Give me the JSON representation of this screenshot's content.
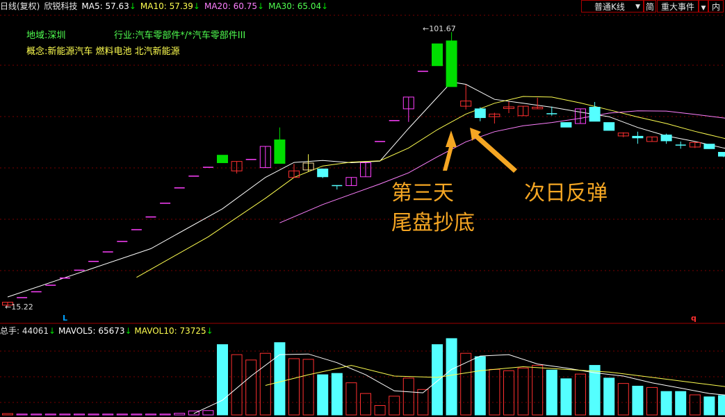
{
  "header": {
    "period": "日线(复权)",
    "stock_name": "欣锐科技",
    "ma5": "MA5: 57.63",
    "ma10": "MA10: 57.39",
    "ma20": "MA20: 60.75",
    "ma30": "MA30: 65.04",
    "arrow": "↓"
  },
  "toolbar": {
    "kline_type": "普通K线",
    "dropdown": "▼",
    "simple": "简",
    "events": "重大事件",
    "inner": "内"
  },
  "info": {
    "region": "地域:深圳",
    "industry": "行业:汽车零部件*/*汽车零部件III",
    "concept": "概念:新能源汽车 燃料电池 北汽新能源"
  },
  "annotations": {
    "day3_line1": "第三天",
    "day3_line2": "尾盘抄底",
    "rebound": "次日反弹"
  },
  "price_labels": {
    "high": "101.67",
    "low": "15.22",
    "left_marker": "L",
    "right_marker": "q"
  },
  "volume_header": {
    "vol": "总手: 44061",
    "mavol5": "MAVOL5: 65673",
    "mavol10": "MAVOL10: 73725",
    "arrow": "↓"
  },
  "colors": {
    "up": "#ff3030",
    "down_green": "#00dd00",
    "down_cyan": "#54ffff",
    "limit_up": "#ff40ff",
    "ma5": "#ffffff",
    "ma10": "#ffff50",
    "ma20": "#ff80ff",
    "annotation": "#f5a623",
    "grid": "#7a0000"
  },
  "chart_data": {
    "type": "candlestick",
    "price_range": [
      15.22,
      101.67
    ],
    "candles": [
      {
        "o": 16.8,
        "c": 15.9,
        "h": 16.8,
        "l": 15.22,
        "kind": "up"
      },
      {
        "o": 18.2,
        "c": 18.2,
        "h": 18.2,
        "l": 18.2,
        "kind": "limit"
      },
      {
        "o": 20.0,
        "c": 20.0,
        "h": 20.0,
        "l": 20.0,
        "kind": "limit"
      },
      {
        "o": 22.0,
        "c": 22.0,
        "h": 22.0,
        "l": 22.0,
        "kind": "limit"
      },
      {
        "o": 24.2,
        "c": 24.2,
        "h": 24.2,
        "l": 24.2,
        "kind": "limit"
      },
      {
        "o": 26.6,
        "c": 26.6,
        "h": 26.6,
        "l": 26.6,
        "kind": "limit"
      },
      {
        "o": 29.3,
        "c": 29.3,
        "h": 29.3,
        "l": 29.3,
        "kind": "limit"
      },
      {
        "o": 32.2,
        "c": 32.2,
        "h": 32.2,
        "l": 32.2,
        "kind": "limit"
      },
      {
        "o": 35.4,
        "c": 35.4,
        "h": 35.4,
        "l": 35.4,
        "kind": "limit"
      },
      {
        "o": 39.0,
        "c": 39.0,
        "h": 39.0,
        "l": 39.0,
        "kind": "limit"
      },
      {
        "o": 42.9,
        "c": 42.9,
        "h": 42.9,
        "l": 42.9,
        "kind": "limit"
      },
      {
        "o": 47.1,
        "c": 47.1,
        "h": 47.1,
        "l": 47.1,
        "kind": "limit"
      },
      {
        "o": 51.8,
        "c": 51.8,
        "h": 51.8,
        "l": 51.8,
        "kind": "limit"
      },
      {
        "o": 55.4,
        "c": 55.4,
        "h": 55.4,
        "l": 55.4,
        "kind": "limit"
      },
      {
        "o": 58.1,
        "c": 58.1,
        "h": 58.1,
        "l": 58.1,
        "kind": "limit"
      },
      {
        "o": 61.8,
        "c": 59.5,
        "h": 61.8,
        "l": 59.5,
        "kind": "green"
      },
      {
        "o": 57.0,
        "c": 59.9,
        "h": 59.9,
        "l": 56.2,
        "kind": "up"
      },
      {
        "o": 60.5,
        "c": 60.5,
        "h": 60.5,
        "l": 60.5,
        "kind": "limit"
      },
      {
        "o": 58.0,
        "c": 64.5,
        "h": 64.5,
        "l": 58.0,
        "kind": "limit_body"
      },
      {
        "o": 66.5,
        "c": 59.3,
        "h": 70.3,
        "l": 59.3,
        "kind": "green"
      },
      {
        "o": 55.0,
        "c": 57.0,
        "h": 59.1,
        "l": 55.0,
        "kind": "up"
      },
      {
        "o": 57.3,
        "c": 59.4,
        "h": 62.1,
        "l": 56.8,
        "kind": "up_yellow"
      },
      {
        "o": 57.6,
        "c": 55.2,
        "h": 57.6,
        "l": 54.8,
        "kind": "cyan"
      },
      {
        "o": 52.5,
        "c": 52.5,
        "h": 52.5,
        "l": 51.3,
        "kind": "cross"
      },
      {
        "o": 52.5,
        "c": 55.0,
        "h": 55.0,
        "l": 52.5,
        "kind": "limit_body"
      },
      {
        "o": 55.2,
        "c": 59.5,
        "h": 59.6,
        "l": 55.2,
        "kind": "limit_body"
      },
      {
        "o": 66.0,
        "c": 66.0,
        "h": 66.0,
        "l": 66.0,
        "kind": "limit"
      },
      {
        "o": 72.4,
        "c": 72.4,
        "h": 72.4,
        "l": 72.4,
        "kind": "limit"
      },
      {
        "o": 76.0,
        "c": 79.6,
        "h": 79.6,
        "l": 72.0,
        "kind": "limit_body"
      },
      {
        "o": 87.5,
        "c": 87.5,
        "h": 87.5,
        "l": 87.5,
        "kind": "limit"
      },
      {
        "o": 89.2,
        "c": 95.9,
        "h": 95.9,
        "l": 89.2,
        "kind": "green"
      },
      {
        "o": 96.8,
        "c": 82.8,
        "h": 99.5,
        "l": 82.8,
        "kind": "green"
      },
      {
        "o": 76.8,
        "c": 78.4,
        "h": 83.4,
        "l": 75.8,
        "kind": "up"
      },
      {
        "o": 76.0,
        "c": 73.3,
        "h": 76.5,
        "l": 72.2,
        "kind": "cyan"
      },
      {
        "o": 73.6,
        "c": 74.4,
        "h": 74.8,
        "l": 71.5,
        "kind": "up"
      },
      {
        "o": 76.1,
        "c": 76.6,
        "h": 78.2,
        "l": 74.7,
        "kind": "up"
      },
      {
        "o": 73.9,
        "c": 76.8,
        "h": 76.8,
        "l": 73.9,
        "kind": "up"
      },
      {
        "o": 76.0,
        "c": 76.5,
        "h": 79.4,
        "l": 76.0,
        "kind": "up"
      },
      {
        "o": 74.1,
        "c": 74.5,
        "h": 76.7,
        "l": 73.9,
        "kind": "cross"
      },
      {
        "o": 71.8,
        "c": 70.4,
        "h": 71.8,
        "l": 70.4,
        "kind": "cyan"
      },
      {
        "o": 71.5,
        "c": 76.0,
        "h": 76.0,
        "l": 71.5,
        "kind": "limit_body"
      },
      {
        "o": 76.5,
        "c": 72.2,
        "h": 78.1,
        "l": 72.2,
        "kind": "cyan"
      },
      {
        "o": 71.8,
        "c": 69.4,
        "h": 71.8,
        "l": 69.4,
        "kind": "cyan"
      },
      {
        "o": 68.6,
        "c": 67.7,
        "h": 68.8,
        "l": 67.3,
        "kind": "up"
      },
      {
        "o": 67.6,
        "c": 67.1,
        "h": 69.0,
        "l": 65.3,
        "kind": "cyan"
      },
      {
        "o": 66.0,
        "c": 67.4,
        "h": 67.4,
        "l": 66.0,
        "kind": "up"
      },
      {
        "o": 68.0,
        "c": 66.2,
        "h": 68.4,
        "l": 65.3,
        "kind": "cyan"
      },
      {
        "o": 64.9,
        "c": 64.8,
        "h": 66.0,
        "l": 63.8,
        "kind": "cross"
      },
      {
        "o": 64.3,
        "c": 65.7,
        "h": 65.7,
        "l": 64.0,
        "kind": "up"
      },
      {
        "o": 65.2,
        "c": 63.8,
        "h": 65.2,
        "l": 63.8,
        "kind": "cyan"
      },
      {
        "o": 62.7,
        "c": 61.5,
        "h": 62.7,
        "l": 61.2,
        "kind": "cyan"
      },
      {
        "o": 61.5,
        "c": 60.3,
        "h": 61.9,
        "l": 60.3,
        "kind": "cyan"
      },
      {
        "o": 58.8,
        "c": 58.8,
        "h": 60.3,
        "l": 58.8,
        "kind": "up"
      }
    ],
    "ma5": [
      [
        0,
        18.4
      ],
      [
        10,
        33.2
      ],
      [
        15,
        45.4
      ],
      [
        18,
        55.0
      ],
      [
        20,
        59.6
      ],
      [
        22,
        60.2
      ],
      [
        24,
        59.5
      ],
      [
        26,
        60.0
      ],
      [
        28,
        70.0
      ],
      [
        30,
        79.5
      ],
      [
        31,
        84.2
      ],
      [
        32,
        83.5
      ],
      [
        34,
        78.9
      ],
      [
        36,
        77.7
      ],
      [
        38,
        76.5
      ],
      [
        40,
        75.0
      ],
      [
        42,
        73.6
      ],
      [
        44,
        70.3
      ],
      [
        46,
        67.7
      ],
      [
        48,
        66.0
      ],
      [
        50,
        64.0
      ],
      [
        52,
        62.5
      ]
    ],
    "ma10": [
      [
        9,
        24.4
      ],
      [
        14,
        36.8
      ],
      [
        18,
        48.6
      ],
      [
        20,
        55.0
      ],
      [
        22,
        58.5
      ],
      [
        24,
        59.7
      ],
      [
        26,
        60.1
      ],
      [
        28,
        64.0
      ],
      [
        30,
        69.6
      ],
      [
        32,
        74.4
      ],
      [
        34,
        77.7
      ],
      [
        36,
        79.8
      ],
      [
        38,
        79.6
      ],
      [
        40,
        77.8
      ],
      [
        42,
        75.7
      ],
      [
        44,
        73.5
      ],
      [
        46,
        71.5
      ],
      [
        48,
        69.1
      ],
      [
        50,
        67.0
      ],
      [
        52,
        64.9
      ]
    ],
    "ma20": [
      [
        19,
        41.1
      ],
      [
        22,
        46.7
      ],
      [
        26,
        53.0
      ],
      [
        28,
        56.4
      ],
      [
        30,
        61.3
      ],
      [
        32,
        65.9
      ],
      [
        34,
        69.0
      ],
      [
        36,
        70.8
      ],
      [
        38,
        71.8
      ],
      [
        40,
        73.1
      ],
      [
        42,
        74.7
      ],
      [
        44,
        75.4
      ],
      [
        46,
        75.3
      ],
      [
        48,
        74.3
      ],
      [
        50,
        73.2
      ],
      [
        52,
        72.0
      ]
    ],
    "ma30": [
      [
        29,
        53.8
      ],
      [
        32,
        57.6
      ],
      [
        34,
        61.1
      ],
      [
        36,
        63.7
      ],
      [
        38,
        65.3
      ],
      [
        40,
        67.3
      ],
      [
        42,
        68.5
      ],
      [
        44,
        69.3
      ],
      [
        46,
        69.0
      ],
      [
        48,
        68.0
      ],
      [
        50,
        66.5
      ],
      [
        52,
        65.6
      ]
    ],
    "volume": {
      "range": [
        0,
        115000
      ],
      "bars": [
        {
          "v": 2000,
          "kind": "up"
        },
        {
          "v": 1300,
          "kind": "limit"
        },
        {
          "v": 1300,
          "kind": "limit"
        },
        {
          "v": 1300,
          "kind": "limit"
        },
        {
          "v": 1300,
          "kind": "limit"
        },
        {
          "v": 1300,
          "kind": "limit"
        },
        {
          "v": 1300,
          "kind": "limit"
        },
        {
          "v": 1300,
          "kind": "limit"
        },
        {
          "v": 1300,
          "kind": "limit"
        },
        {
          "v": 1300,
          "kind": "limit"
        },
        {
          "v": 1300,
          "kind": "limit"
        },
        {
          "v": 1300,
          "kind": "limit"
        },
        {
          "v": 2500,
          "kind": "limit"
        },
        {
          "v": 6000,
          "kind": "limit"
        },
        {
          "v": 6500,
          "kind": "limit"
        },
        {
          "v": 105000,
          "kind": "cyan"
        },
        {
          "v": 90000,
          "kind": "up"
        },
        {
          "v": 82000,
          "kind": "up"
        },
        {
          "v": 92000,
          "kind": "up"
        },
        {
          "v": 108000,
          "kind": "cyan"
        },
        {
          "v": 84000,
          "kind": "up"
        },
        {
          "v": 83000,
          "kind": "up"
        },
        {
          "v": 60000,
          "kind": "cyan"
        },
        {
          "v": 62000,
          "kind": "cyan"
        },
        {
          "v": 48000,
          "kind": "up"
        },
        {
          "v": 32000,
          "kind": "up"
        },
        {
          "v": 14000,
          "kind": "up"
        },
        {
          "v": 28000,
          "kind": "up"
        },
        {
          "v": 55000,
          "kind": "up"
        },
        {
          "v": 38000,
          "kind": "up"
        },
        {
          "v": 105000,
          "kind": "cyan"
        },
        {
          "v": 114000,
          "kind": "cyan"
        },
        {
          "v": 92000,
          "kind": "up"
        },
        {
          "v": 87000,
          "kind": "cyan"
        },
        {
          "v": 68000,
          "kind": "up"
        },
        {
          "v": 66000,
          "kind": "up"
        },
        {
          "v": 70000,
          "kind": "up"
        },
        {
          "v": 74000,
          "kind": "up"
        },
        {
          "v": 67000,
          "kind": "cyan"
        },
        {
          "v": 54000,
          "kind": "cyan"
        },
        {
          "v": 61000,
          "kind": "up"
        },
        {
          "v": 74000,
          "kind": "cyan"
        },
        {
          "v": 55000,
          "kind": "cyan"
        },
        {
          "v": 47000,
          "kind": "up"
        },
        {
          "v": 43000,
          "kind": "cyan"
        },
        {
          "v": 41000,
          "kind": "up"
        },
        {
          "v": 35000,
          "kind": "cyan"
        },
        {
          "v": 35000,
          "kind": "cyan"
        },
        {
          "v": 30000,
          "kind": "up"
        },
        {
          "v": 27000,
          "kind": "cyan"
        },
        {
          "v": 29000,
          "kind": "cyan"
        },
        {
          "v": 25000,
          "kind": "cyan"
        },
        {
          "v": 30000,
          "kind": "up"
        }
      ],
      "mavol5": [
        [
          13,
          2000
        ],
        [
          15,
          22000
        ],
        [
          17,
          58000
        ],
        [
          19,
          90000
        ],
        [
          21,
          91000
        ],
        [
          23,
          78000
        ],
        [
          25,
          60000
        ],
        [
          27,
          36000
        ],
        [
          29,
          33000
        ],
        [
          31,
          68000
        ],
        [
          33,
          88000
        ],
        [
          35,
          90000
        ],
        [
          37,
          76000
        ],
        [
          39,
          70000
        ],
        [
          41,
          63000
        ],
        [
          43,
          58000
        ],
        [
          45,
          48000
        ],
        [
          47,
          40000
        ],
        [
          49,
          32000
        ],
        [
          51,
          28000
        ],
        [
          52,
          26000
        ]
      ],
      "mavol10": [
        [
          18,
          44000
        ],
        [
          21,
          60000
        ],
        [
          24,
          74000
        ],
        [
          27,
          58000
        ],
        [
          30,
          56000
        ],
        [
          33,
          66000
        ],
        [
          36,
          72000
        ],
        [
          39,
          68000
        ],
        [
          42,
          64000
        ],
        [
          45,
          56000
        ],
        [
          48,
          48000
        ],
        [
          51,
          40000
        ],
        [
          52,
          37000
        ]
      ]
    }
  }
}
